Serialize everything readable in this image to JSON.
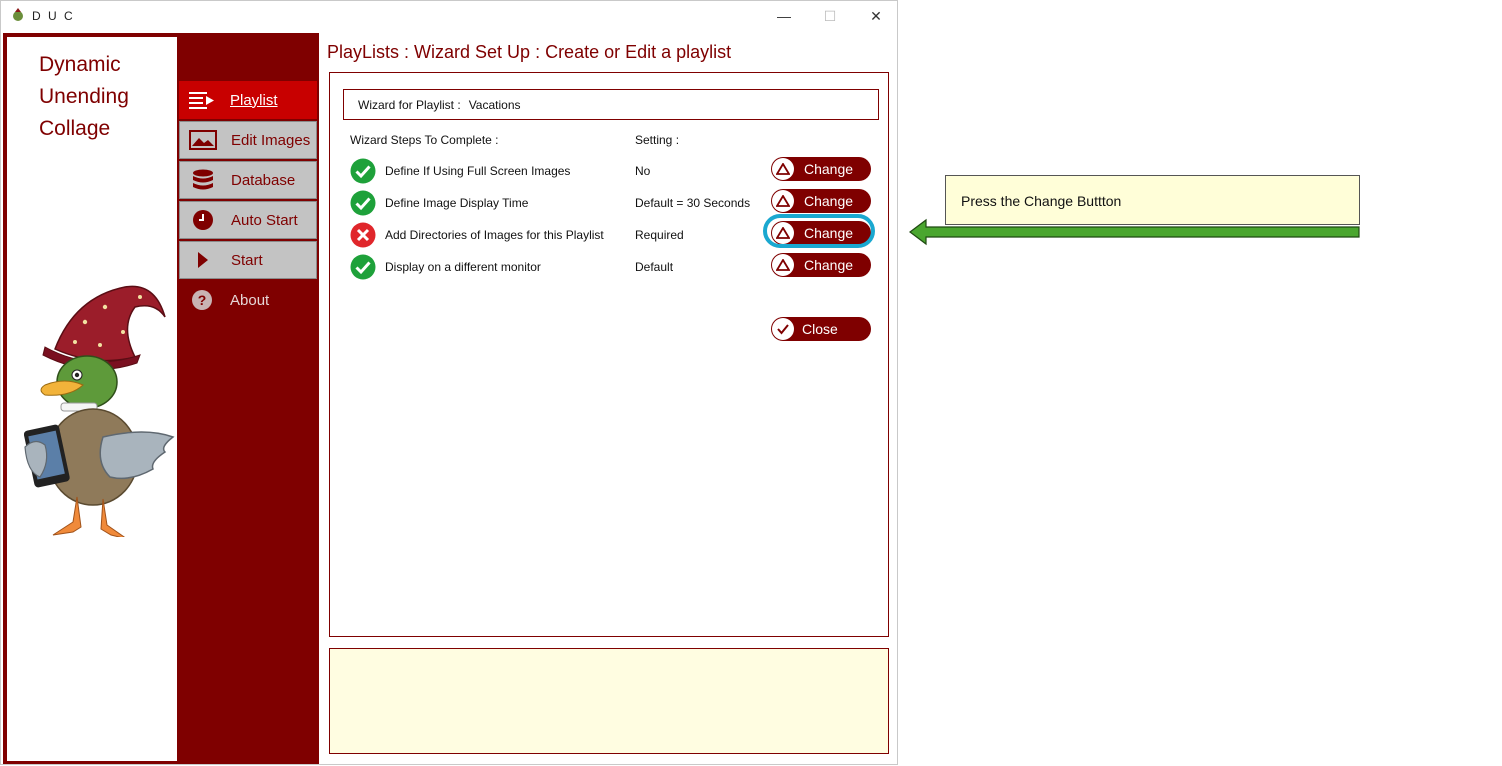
{
  "window": {
    "title": "D U C",
    "minimize": "—",
    "maximize": "☐",
    "close": "✕"
  },
  "logo": {
    "line1": "Dynamic",
    "line2": "Unending",
    "line3": "Collage"
  },
  "nav": {
    "items": [
      {
        "label": "Playlist",
        "icon": "playlist-icon"
      },
      {
        "label": "Edit Images",
        "icon": "image-icon"
      },
      {
        "label": "Database",
        "icon": "database-icon"
      },
      {
        "label": "Auto Start",
        "icon": "clock-icon"
      },
      {
        "label": "Start",
        "icon": "play-icon"
      },
      {
        "label": "About",
        "icon": "help-icon"
      }
    ]
  },
  "page": {
    "title": "PlayLists : Wizard Set Up : Create or Edit a playlist"
  },
  "wizard": {
    "name_label": "Wizard for Playlist :",
    "name_value": "Vacations",
    "steps_header": "Wizard Steps To Complete :",
    "setting_header": "Setting :",
    "steps": [
      {
        "label": "Define If Using Full Screen Images",
        "value": "No",
        "status": "complete",
        "button": "Change"
      },
      {
        "label": "Define Image Display Time",
        "value": "Default = 30 Seconds",
        "status": "complete",
        "button": "Change"
      },
      {
        "label": "Add Directories of Images for this Playlist",
        "value": "Required",
        "status": "incomplete",
        "button": "Change"
      },
      {
        "label": "Display on a different monitor",
        "value": "Default",
        "status": "complete",
        "button": "Change"
      }
    ],
    "close_label": "Close"
  },
  "callout": {
    "text": "Press the Change Buttton"
  },
  "colors": {
    "brand": "#7f0000",
    "active_nav": "#c80000",
    "complete": "#1ea13a",
    "incomplete": "#e0262b",
    "highlight": "#1aa8d0",
    "arrow": "#4aa62f"
  }
}
